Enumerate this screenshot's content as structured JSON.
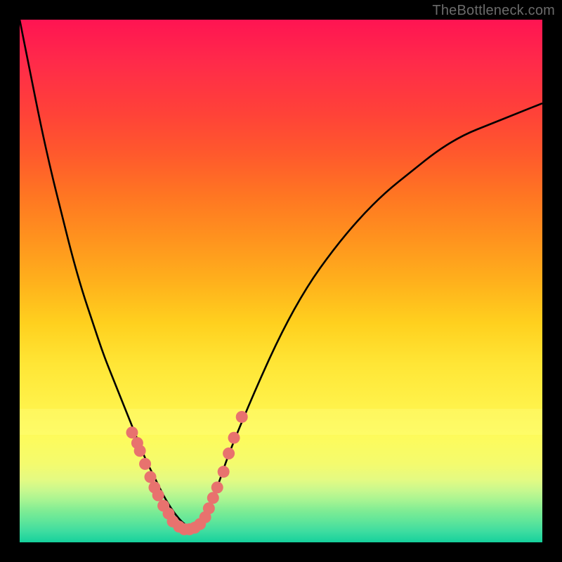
{
  "watermark": "TheBottleneck.com",
  "colors": {
    "frame": "#000000",
    "curve": "#000000",
    "dot_fill": "#e8726e",
    "dot_stroke": "#c75550"
  },
  "chart_data": {
    "type": "line",
    "title": "",
    "xlabel": "",
    "ylabel": "",
    "xlim": [
      0,
      100
    ],
    "ylim": [
      0,
      100
    ],
    "legend": false,
    "grid": false,
    "note": "axes are unlabeled; values are percentages of plot area (x right, y up)",
    "series": [
      {
        "name": "bottleneck-curve",
        "style": "line",
        "x": [
          0,
          2,
          4,
          6,
          8,
          10,
          12,
          14,
          16,
          18,
          20,
          22,
          24,
          26,
          28,
          30,
          32,
          34,
          36,
          38,
          40,
          45,
          50,
          55,
          60,
          65,
          70,
          75,
          80,
          85,
          90,
          95,
          100
        ],
        "y": [
          100,
          90,
          80,
          71,
          63,
          55,
          48,
          42,
          36,
          31,
          26,
          21,
          16,
          12,
          8,
          5,
          3,
          3,
          6,
          11,
          17,
          29,
          40,
          49,
          56,
          62,
          67,
          71,
          75,
          78,
          80,
          82,
          84
        ]
      },
      {
        "name": "highlight-dots",
        "style": "scatter",
        "x": [
          21.5,
          22.5,
          23.0,
          24.0,
          25.0,
          25.8,
          26.5,
          27.5,
          28.5,
          29.3,
          30.5,
          31.5,
          32.5,
          33.5,
          34.5,
          35.5,
          36.2,
          37.0,
          37.8,
          39.0,
          40.0,
          41.0,
          42.5
        ],
        "y": [
          21.0,
          19.0,
          17.5,
          15.0,
          12.5,
          10.5,
          9.0,
          7.0,
          5.5,
          4.0,
          3.0,
          2.5,
          2.5,
          2.8,
          3.5,
          4.8,
          6.5,
          8.5,
          10.5,
          13.5,
          17.0,
          20.0,
          24.0
        ]
      }
    ]
  }
}
